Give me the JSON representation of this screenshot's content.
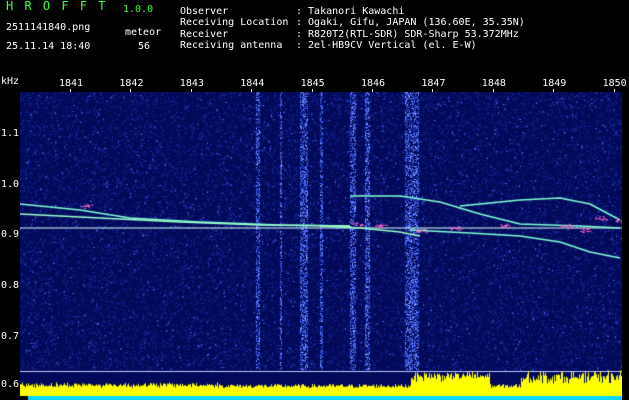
{
  "app": {
    "name": "H R O F F T",
    "version": "1.0.0",
    "filename": "2511141840.png",
    "datetime": "25.11.14 18:40",
    "meteor_label": "meteor",
    "meteor_count": "56"
  },
  "info": {
    "observer_label": "Observer",
    "observer": ": Takanori Kawachi",
    "location_label": "Receiving Location",
    "location": ": Ogaki, Gifu, JAPAN (136.60E, 35.35N)",
    "receiver_label": "Receiver",
    "receiver": ": R820T2(RTL-SDR) SDR-Sharp 53.372MHz",
    "antenna_label": "Receiving antenna",
    "antenna": ": 2el-HB9CV Vertical (el. E-W)"
  },
  "axis": {
    "unit": "kHz",
    "time_ticks": [
      "1841",
      "1842",
      "1843",
      "1844",
      "1845",
      "1846",
      "1847",
      "1848",
      "1849",
      "1850"
    ],
    "freq_ticks": [
      "1.1",
      "1.0",
      "0.9",
      "0.8",
      "0.7",
      "0.6"
    ]
  },
  "colors": {
    "background": "#030a5a",
    "noise_dim": "#1a2aa0",
    "noise_bright": "#4a6cff",
    "signal": "#7fffd4",
    "echo": "#ff66cc",
    "level": "#ffff00",
    "cyan_base": "#00d8ff",
    "text_green": "#3cff3c"
  }
}
